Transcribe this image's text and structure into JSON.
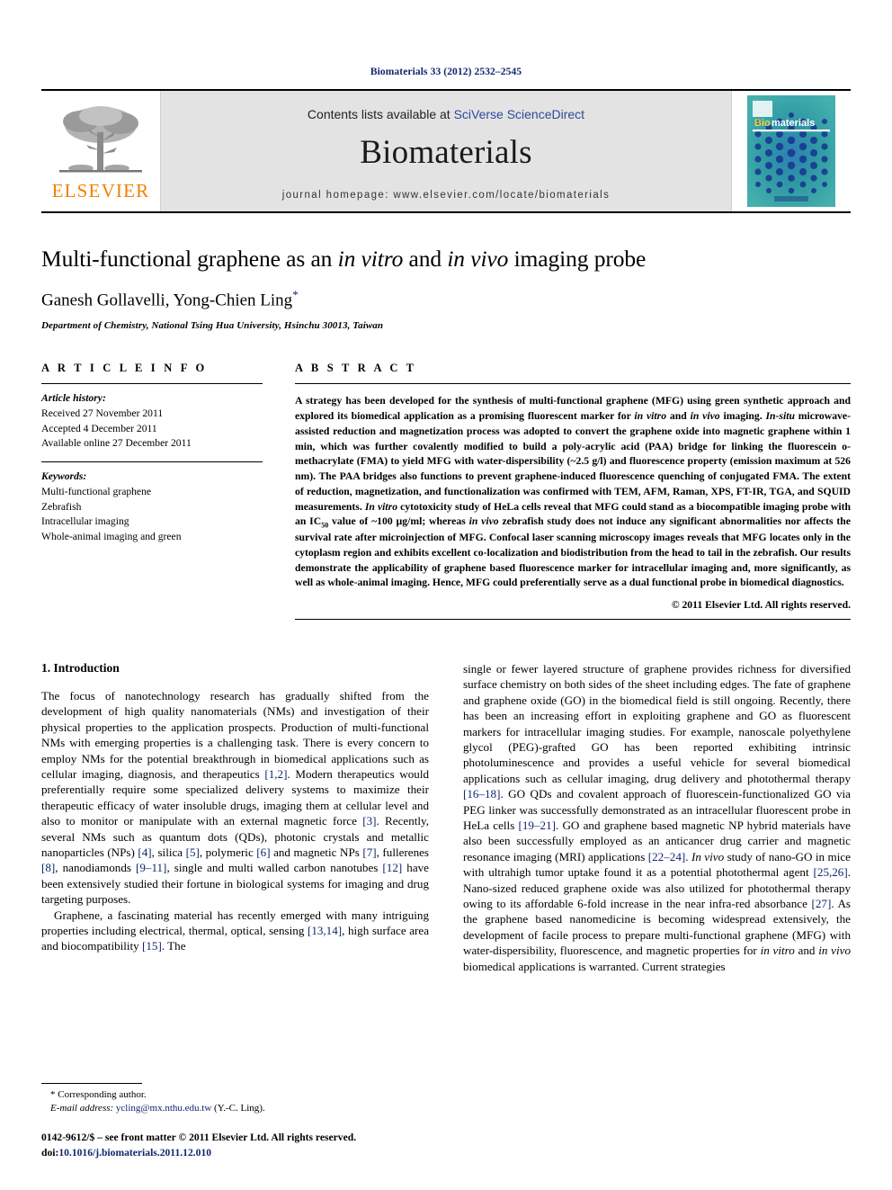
{
  "running_head": "Biomaterials 33 (2012) 2532–2545",
  "banner": {
    "publisher_logo_text": "ELSEVIER",
    "contents_prefix": "Contents lists available at ",
    "contents_link": "SciVerse ScienceDirect",
    "journal_title": "Biomaterials",
    "homepage": "journal homepage: www.elsevier.com/locate/biomaterials",
    "cover_title_prefix": "Bio",
    "cover_title_rest": "materials",
    "cover_bg_color": "#3aa0a6",
    "cover_dot_color": "#1b3f9e",
    "elsevier_orange": "#f08000"
  },
  "article": {
    "title_part1": "Multi-functional graphene as an ",
    "title_italic1": "in vitro",
    "title_part2": " and ",
    "title_italic2": "in vivo",
    "title_part3": " imaging probe",
    "authors": "Ganesh Gollavelli, Yong-Chien Ling",
    "corresponding_marker": "*",
    "affiliation": "Department of Chemistry, National Tsing Hua University, Hsinchu 30013, Taiwan"
  },
  "article_info": {
    "heading": "A R T I C L E  I N F O",
    "history_label": "Article history:",
    "history": [
      "Received 27 November 2011",
      "Accepted 4 December 2011",
      "Available online 27 December 2011"
    ],
    "keywords_label": "Keywords:",
    "keywords": [
      "Multi-functional graphene",
      "Zebrafish",
      "Intracellular imaging",
      "Whole-animal imaging and green"
    ]
  },
  "abstract": {
    "heading": "A B S T R A C T",
    "paragraph_segments": [
      {
        "t": "A strategy has been developed for the synthesis of multi-functional graphene (MFG) using green synthetic approach and explored its biomedical application as a promising fluorescent marker for "
      },
      {
        "t": "in vitro",
        "i": true
      },
      {
        "t": " and "
      },
      {
        "t": "in vivo",
        "i": true
      },
      {
        "t": " imaging. "
      },
      {
        "t": "In-situ",
        "i": true
      },
      {
        "t": " microwave-assisted reduction and magnetization process was adopted to convert the graphene oxide into magnetic graphene within 1 min, which was further covalently modified to build a poly-acrylic acid (PAA) bridge for linking the fluorescein o-methacrylate (FMA) to yield MFG with water-dispersibility (~2.5 g/l) and fluorescence property (emission maximum at 526 nm). The PAA bridges also functions to prevent graphene-induced fluorescence quenching of conjugated FMA. The extent of reduction, magnetization, and functionalization was confirmed with TEM, AFM, Raman, XPS, FT-IR, TGA, and SQUID measurements. "
      },
      {
        "t": "In vitro",
        "i": true
      },
      {
        "t": " cytotoxicity study of HeLa cells reveal that MFG could stand as a biocompatible imaging probe with an IC"
      },
      {
        "t": "50",
        "sub": true
      },
      {
        "t": " value of ~100 µg/ml; whereas "
      },
      {
        "t": "in vivo",
        "i": true
      },
      {
        "t": " zebrafish study does not induce any significant abnormalities nor affects the survival rate after microinjection of MFG. Confocal laser scanning microscopy images reveals that MFG locates only in the cytoplasm region and exhibits excellent co-localization and biodistribution from the head to tail in the zebrafish. Our results demonstrate the applicability of graphene based fluorescence marker for intracellular imaging and, more significantly, as well as whole-animal imaging. Hence, MFG could preferentially serve as a dual functional probe in biomedical diagnostics."
      }
    ],
    "copyright": "© 2011 Elsevier Ltd. All rights reserved."
  },
  "introduction": {
    "heading": "1. Introduction",
    "left_paragraphs": [
      [
        {
          "t": "The focus of nanotechnology research has gradually shifted from the development of high quality nanomaterials (NMs) and investigation of their physical properties to the application prospects. Production of multi-functional NMs with emerging properties is a challenging task. There is every concern to employ NMs for the potential breakthrough in biomedical applications such as cellular imaging, diagnosis, and therapeutics "
        },
        {
          "t": "[1,2]",
          "ref": true
        },
        {
          "t": ". Modern therapeutics would preferentially require some specialized delivery systems to maximize their therapeutic efficacy of water insoluble drugs, imaging them at cellular level and also to monitor or manipulate with an external magnetic force "
        },
        {
          "t": "[3]",
          "ref": true
        },
        {
          "t": ". Recently, several NMs such as quantum dots (QDs), photonic crystals and metallic nanoparticles (NPs) "
        },
        {
          "t": "[4]",
          "ref": true
        },
        {
          "t": ", silica "
        },
        {
          "t": "[5]",
          "ref": true
        },
        {
          "t": ", polymeric "
        },
        {
          "t": "[6]",
          "ref": true
        },
        {
          "t": " and magnetic NPs "
        },
        {
          "t": "[7]",
          "ref": true
        },
        {
          "t": ", fullerenes "
        },
        {
          "t": "[8]",
          "ref": true
        },
        {
          "t": ", nanodiamonds "
        },
        {
          "t": "[9–11]",
          "ref": true
        },
        {
          "t": ", single and multi walled carbon nanotubes "
        },
        {
          "t": "[12]",
          "ref": true
        },
        {
          "t": " have been extensively studied their fortune in biological systems for imaging and drug targeting purposes."
        }
      ],
      [
        {
          "t": "Graphene, a fascinating material has recently emerged with many intriguing properties including electrical, thermal, optical, sensing "
        },
        {
          "t": "[13,14]",
          "ref": true
        },
        {
          "t": ", high surface area and biocompatibility "
        },
        {
          "t": "[15]",
          "ref": true
        },
        {
          "t": ". The"
        }
      ]
    ],
    "right_paragraphs": [
      [
        {
          "t": "single or fewer layered structure of graphene provides richness for diversified surface chemistry on both sides of the sheet including edges. The fate of graphene and graphene oxide (GO) in the biomedical field is still ongoing. Recently, there has been an increasing effort in exploiting graphene and GO as fluorescent markers for intracellular imaging studies. For example, nanoscale polyethylene glycol (PEG)-grafted GO has been reported exhibiting intrinsic photoluminescence and provides a useful vehicle for several biomedical applications such as cellular imaging, drug delivery and photothermal therapy "
        },
        {
          "t": "[16–18]",
          "ref": true
        },
        {
          "t": ". GO QDs and covalent approach of fluorescein-functionalized GO via PEG linker was successfully demonstrated as an intracellular fluorescent probe in HeLa cells "
        },
        {
          "t": "[19–21]",
          "ref": true
        },
        {
          "t": ". GO and graphene based magnetic NP hybrid materials have also been successfully employed as an anticancer drug carrier and magnetic resonance imaging (MRI) applications "
        },
        {
          "t": "[22–24]",
          "ref": true
        },
        {
          "t": ". "
        },
        {
          "t": "In vivo",
          "i": true
        },
        {
          "t": " study of nano-GO in mice with ultrahigh tumor uptake found it as a potential photothermal agent "
        },
        {
          "t": "[25,26]",
          "ref": true
        },
        {
          "t": ". Nano-sized reduced graphene oxide was also utilized for photothermal therapy owing to its affordable 6-fold increase in the near infra-red absorbance "
        },
        {
          "t": "[27]",
          "ref": true
        },
        {
          "t": ". As the graphene based nanomedicine is becoming widespread extensively, the development of facile process to prepare multi-functional graphene (MFG) with water-dispersibility, fluorescence, and magnetic properties for "
        },
        {
          "t": "in vitro",
          "i": true
        },
        {
          "t": " and "
        },
        {
          "t": "in vivo",
          "i": true
        },
        {
          "t": " biomedical applications is warranted. Current strategies"
        }
      ]
    ]
  },
  "footnote": {
    "corresponding": "* Corresponding author.",
    "email_label": "E-mail address:",
    "email": "ycling@mx.nthu.edu.tw",
    "email_suffix": "(Y.-C. Ling)."
  },
  "footer": {
    "front_matter": "0142-9612/$ – see front matter © 2011 Elsevier Ltd. All rights reserved.",
    "doi_label": "doi:",
    "doi": "10.1016/j.biomaterials.2011.12.010"
  }
}
